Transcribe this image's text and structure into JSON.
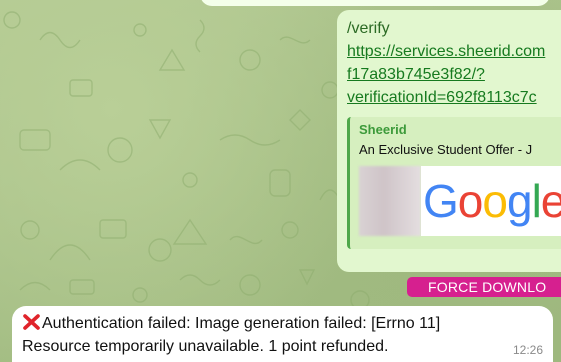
{
  "outgoing_message": {
    "command": "/verify",
    "link_lines": [
      "https://services.sheerid.com",
      "f17a83b745e3f82/?",
      "verificationId=692f8113c7c"
    ],
    "preview": {
      "site_name": "Sheerid",
      "title": "An Exclusive Student Offer - J",
      "logo_letters": [
        "G",
        "o",
        "o",
        "g",
        "l",
        "e"
      ],
      "logo_colors": [
        "#4285F4",
        "#EA4335",
        "#FBBC05",
        "#4285F4",
        "#34A853",
        "#EA4335"
      ]
    }
  },
  "inline_button": {
    "label": "FORCE DOWNLO"
  },
  "incoming_message": {
    "icon": "red-cross-mark-icon",
    "line1": "Authentication failed: Image generation failed: [Errno 11]",
    "line2": "Resource temporarily unavailable. 1 point refunded.",
    "time": "12:26"
  },
  "colors": {
    "outgoing_bubble": "#e2f7cf",
    "incoming_bubble": "#ffffff",
    "button": "#d6208f",
    "link": "#167a1f",
    "preview_accent": "#4fa84a"
  }
}
